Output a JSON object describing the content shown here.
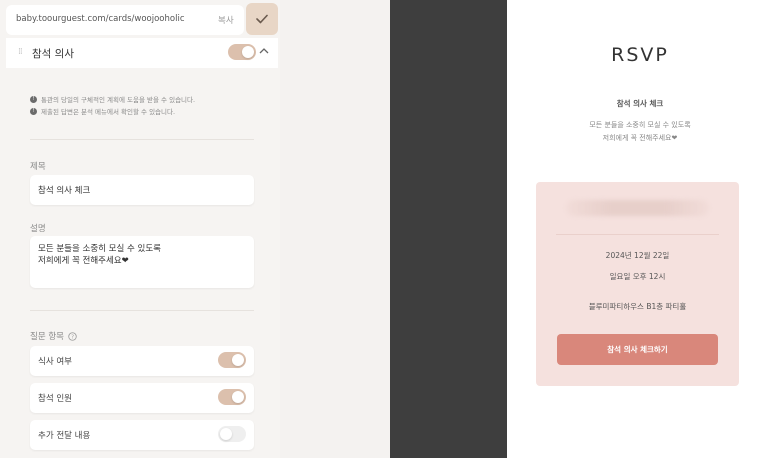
{
  "url_bar": {
    "url": "baby.toourguest.com/cards/woojooholic",
    "copy_label": "복사"
  },
  "section": {
    "title": "참석 의사",
    "enabled": true
  },
  "info": [
    "통관의 당일의 구체적인 계획에 도움을 받을 수 있습니다.",
    "제출된 답변은 분석 메뉴에서 확인할 수 있습니다."
  ],
  "title_field": {
    "label": "제목",
    "value": "참석 의사 체크"
  },
  "desc_field": {
    "label": "설명",
    "value": "모든 분들을 소중히 모실 수 있도록\n저희에게 꼭 전해주세요❤"
  },
  "questions": {
    "label": "질문 항목",
    "items": [
      {
        "label": "식사 여부",
        "enabled": true
      },
      {
        "label": "참석 인원",
        "enabled": true
      },
      {
        "label": "추가 전달 내용",
        "enabled": false
      }
    ]
  },
  "preview": {
    "heading": "RSVP",
    "subtitle": "참석 의사 체크",
    "description": "모든 분들을 소중히 모실 수 있도록\n저희에게 꼭 전해주세요❤",
    "date": "2024년 12월 22일",
    "time": "일요일 오후 12시",
    "venue": "블루미파티하우스 B1층 파티홀",
    "button": "참석 의사 체크하기"
  },
  "colors": {
    "accent": "#d9877b",
    "toggle_on": "#dcc0ad",
    "card_bg": "#f5e1de",
    "dark_bg": "#3e3e3e"
  }
}
